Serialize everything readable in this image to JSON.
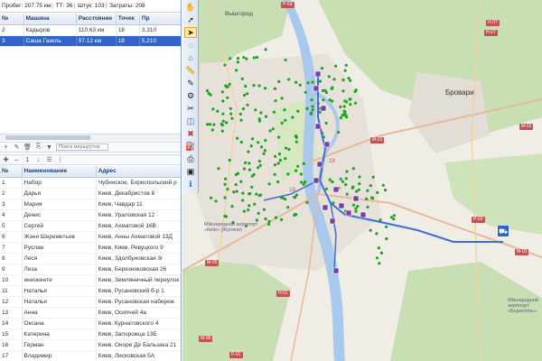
{
  "status": {
    "mileage_label": "Пробег:",
    "mileage_value": "207.75 км",
    "points_label": "ТТ:",
    "points_value": "36",
    "pieces_label": "Штук:",
    "pieces_value": "103",
    "cost_label": "Затраты:",
    "cost_value": "208"
  },
  "routes": {
    "columns": [
      "№",
      "Машина",
      "Расстояние",
      "Точек",
      "Пр"
    ],
    "rows": [
      {
        "num": "2",
        "car": "Кадыров",
        "distance": "110.63 км",
        "points": "18",
        "extra": "3,310"
      },
      {
        "num": "3",
        "car": "Саша Газель",
        "distance": "97.12 км",
        "points": "18",
        "extra": "5,210",
        "selected": true
      }
    ]
  },
  "routes_toolbar": {
    "search_placeholder": "Поиск маршрутов"
  },
  "points_toolbar": {
    "count": "1"
  },
  "points": {
    "columns": [
      "№",
      "Наименование",
      "Адрес"
    ],
    "rows": [
      {
        "num": "1",
        "name": "Набор",
        "addr": "Чубинское, Бориспольский р"
      },
      {
        "num": "2",
        "name": "Дарья",
        "addr": "Киев, Декабристов 8"
      },
      {
        "num": "3",
        "name": "Мария",
        "addr": "Киев, Чавдар 11"
      },
      {
        "num": "4",
        "name": "Денис",
        "addr": "Киев, Ураловская 12"
      },
      {
        "num": "5",
        "name": "Сергей",
        "addr": "Киев, Ахматовой 16В"
      },
      {
        "num": "6",
        "name": "Жэня Шереметьев",
        "addr": "Киев, Анны Ахматовой 13Д"
      },
      {
        "num": "7",
        "name": "Руслан",
        "addr": "Киев, Киев, Ревуцкого 9"
      },
      {
        "num": "8",
        "name": "Леся",
        "addr": "Киев, Здолбуновская 3г"
      },
      {
        "num": "9",
        "name": "Лиза",
        "addr": "Киев, Березняковская 26"
      },
      {
        "num": "10",
        "name": "иннокенти",
        "addr": "Киев, Земляничный переулок"
      },
      {
        "num": "11",
        "name": "Наталья",
        "addr": "Киев, Русановский б-р 1"
      },
      {
        "num": "12",
        "name": "Наталья",
        "addr": "Киев, Русановская набереж"
      },
      {
        "num": "13",
        "name": "Анна",
        "addr": "Киев, Осипчей 4а"
      },
      {
        "num": "14",
        "name": "Оксана",
        "addr": "Киев, Курнатовского 4"
      },
      {
        "num": "15",
        "name": "Катерина",
        "addr": "Киев, Запорожца 13Б"
      },
      {
        "num": "16",
        "name": "Герман",
        "addr": "Киев, Оноре Де Бальзака 21"
      },
      {
        "num": "17",
        "name": "Владимир",
        "addr": "Киев, Лисковская 5А"
      }
    ]
  },
  "map": {
    "labels": {
      "vyshgorod": "Вышгород",
      "brovary": "Бровари",
      "airport": "Міжнародний аеропорт «Київ» (Жуляни)",
      "boryspil": "Міжнародний аеропорт «Бориспіль»"
    },
    "roads": [
      "Р-69",
      "Н-07",
      "Н-07",
      "М-01",
      "М-01",
      "Р-03",
      "М-03",
      "М-05",
      "Н-01",
      "Р-01",
      "М-06"
    ],
    "route_labels": [
      "19",
      "18"
    ],
    "colors": {
      "route": "#3b6fd8",
      "poi": "#1fa31f",
      "forest": "#c8dfb3",
      "urban": "#ece9e2",
      "water": "#a9c9ec"
    }
  }
}
